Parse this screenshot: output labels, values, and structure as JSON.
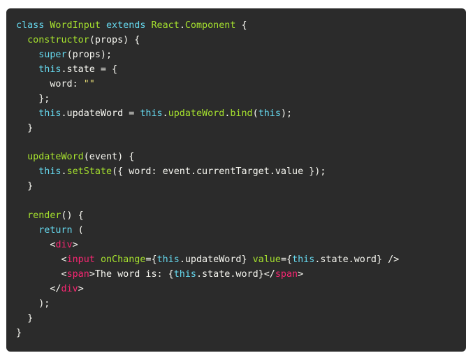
{
  "colors": {
    "background": "#2b2b2b",
    "plain": "#f8f8f2",
    "keyword": "#66d9ef",
    "class_function": "#a6e22e",
    "tag": "#f92672",
    "string": "#e6db74"
  },
  "lines": [
    [
      [
        "kw",
        "class"
      ],
      [
        "plain",
        " "
      ],
      [
        "cls",
        "WordInput"
      ],
      [
        "plain",
        " "
      ],
      [
        "kw",
        "extends"
      ],
      [
        "plain",
        " "
      ],
      [
        "cls",
        "React"
      ],
      [
        "plain",
        "."
      ],
      [
        "cls",
        "Component"
      ],
      [
        "plain",
        " {"
      ]
    ],
    [
      [
        "plain",
        "  "
      ],
      [
        "fn",
        "constructor"
      ],
      [
        "plain",
        "(props) {"
      ]
    ],
    [
      [
        "plain",
        "    "
      ],
      [
        "kw",
        "super"
      ],
      [
        "plain",
        "(props);"
      ]
    ],
    [
      [
        "plain",
        "    "
      ],
      [
        "kw",
        "this"
      ],
      [
        "plain",
        ".state = {"
      ]
    ],
    [
      [
        "plain",
        "      word: "
      ],
      [
        "str",
        "\"\""
      ]
    ],
    [
      [
        "plain",
        "    };"
      ]
    ],
    [
      [
        "plain",
        "    "
      ],
      [
        "kw",
        "this"
      ],
      [
        "plain",
        ".updateWord = "
      ],
      [
        "kw",
        "this"
      ],
      [
        "plain",
        "."
      ],
      [
        "fn",
        "updateWord"
      ],
      [
        "plain",
        "."
      ],
      [
        "fn",
        "bind"
      ],
      [
        "plain",
        "("
      ],
      [
        "kw",
        "this"
      ],
      [
        "plain",
        ");"
      ]
    ],
    [
      [
        "plain",
        "  }"
      ]
    ],
    [
      [
        "plain",
        ""
      ]
    ],
    [
      [
        "plain",
        "  "
      ],
      [
        "fn",
        "updateWord"
      ],
      [
        "plain",
        "(event) {"
      ]
    ],
    [
      [
        "plain",
        "    "
      ],
      [
        "kw",
        "this"
      ],
      [
        "plain",
        "."
      ],
      [
        "fn",
        "setState"
      ],
      [
        "plain",
        "({ word: event.currentTarget.value });"
      ]
    ],
    [
      [
        "plain",
        "  }"
      ]
    ],
    [
      [
        "plain",
        ""
      ]
    ],
    [
      [
        "plain",
        "  "
      ],
      [
        "fn",
        "render"
      ],
      [
        "plain",
        "() {"
      ]
    ],
    [
      [
        "plain",
        "    "
      ],
      [
        "kw",
        "return"
      ],
      [
        "plain",
        " ("
      ]
    ],
    [
      [
        "plain",
        "      <"
      ],
      [
        "tag",
        "div"
      ],
      [
        "plain",
        ">"
      ]
    ],
    [
      [
        "plain",
        "        <"
      ],
      [
        "tag",
        "input"
      ],
      [
        "plain",
        " "
      ],
      [
        "fn",
        "onChange"
      ],
      [
        "plain",
        "={"
      ],
      [
        "kw",
        "this"
      ],
      [
        "plain",
        ".updateWord} "
      ],
      [
        "fn",
        "value"
      ],
      [
        "plain",
        "={"
      ],
      [
        "kw",
        "this"
      ],
      [
        "plain",
        ".state.word} />"
      ]
    ],
    [
      [
        "plain",
        "        <"
      ],
      [
        "tag",
        "span"
      ],
      [
        "plain",
        ">The word is: {"
      ],
      [
        "kw",
        "this"
      ],
      [
        "plain",
        ".state.word}</"
      ],
      [
        "tag",
        "span"
      ],
      [
        "plain",
        ">"
      ]
    ],
    [
      [
        "plain",
        "      </"
      ],
      [
        "tag",
        "div"
      ],
      [
        "plain",
        ">"
      ]
    ],
    [
      [
        "plain",
        "    );"
      ]
    ],
    [
      [
        "plain",
        "  }"
      ]
    ],
    [
      [
        "plain",
        "}"
      ]
    ]
  ]
}
